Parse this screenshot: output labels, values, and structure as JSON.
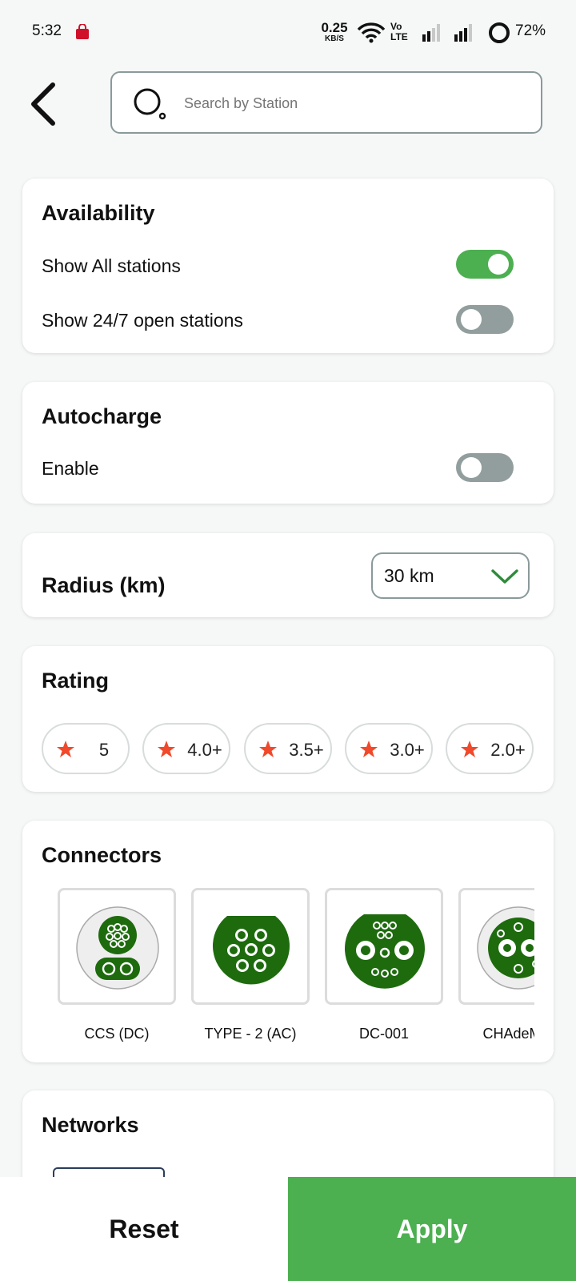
{
  "status_bar": {
    "time": "5:32",
    "net_speed": "0.25",
    "net_speed_unit": "KB/S",
    "volte_line1": "Vo",
    "volte_line2": "LTE",
    "battery": "72%",
    "battery_level": 0.72
  },
  "header": {
    "back_icon": "chevron-left-icon",
    "search_placeholder": "Search by Station"
  },
  "availability": {
    "title": "Availability",
    "rows": [
      {
        "label": "Show All stations",
        "enabled": true
      },
      {
        "label": "Show 24/7 open stations",
        "enabled": false
      }
    ]
  },
  "autocharge": {
    "title": "Autocharge",
    "row_label": "Enable",
    "enabled": false
  },
  "radius": {
    "title": "Radius (km)",
    "selected": "30 km"
  },
  "rating": {
    "title": "Rating",
    "chips": [
      "5",
      "4.0+",
      "3.5+",
      "3.0+",
      "2.0+"
    ]
  },
  "connectors": {
    "title": "Connectors",
    "items": [
      "CCS (DC)",
      "TYPE - 2 (AC)",
      "DC-001",
      "CHAdeMO"
    ]
  },
  "networks": {
    "title": "Networks"
  },
  "actions": {
    "reset": "Reset",
    "apply": "Apply"
  },
  "colors": {
    "accent_green": "#4caf50",
    "connector_green": "#1e6b0e",
    "star": "#f0492b",
    "toggle_off": "#929e9d"
  }
}
